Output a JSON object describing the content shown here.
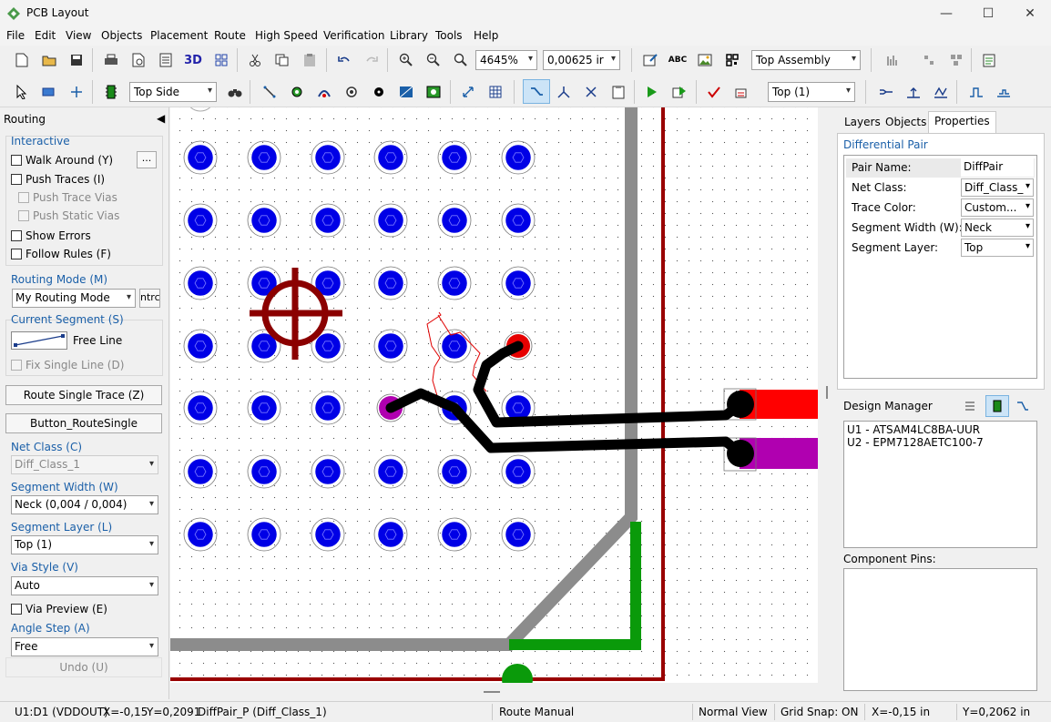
{
  "window": {
    "title": "PCB Layout",
    "minimize": "—",
    "maximize": "☐",
    "close": "✕"
  },
  "menu": [
    "File",
    "Edit",
    "View",
    "Objects",
    "Placement",
    "Route",
    "High Speed",
    "Verification",
    "Library",
    "Tools",
    "Help"
  ],
  "toolbar": {
    "zoom_value": "4645%",
    "grid_value": "0,00625 ir",
    "assembly_view": "Top Assembly",
    "side": "Top Side",
    "layer": "Top (1)",
    "label_3d": "3D",
    "label_abc": "ABC"
  },
  "left_panel": {
    "title": "Routing",
    "interactive": "Interactive",
    "walk_around": "Walk Around (Y)",
    "more": "...",
    "push_traces": "Push Traces (I)",
    "push_trace_vias": "Push Trace Vias",
    "push_static_vias": "Push Static Vias",
    "show_errors": "Show Errors",
    "follow_rules": "Follow Rules (F)",
    "routing_mode_label": "Routing Mode (M)",
    "routing_mode": "My Routing Mode",
    "routing_mode_btn": "ntrc",
    "current_segment_label": "Current Segment (S)",
    "segment_type": "Free Line",
    "fix_single_line": "Fix Single Line (D)",
    "route_single": "Route Single Trace (Z)",
    "button_route_single": "Button_RouteSingle",
    "net_class_label": "Net Class (C)",
    "net_class": "Diff_Class_1",
    "segment_width_label": "Segment Width (W)",
    "segment_width": "Neck (0,004 / 0,004)",
    "segment_layer_label": "Segment Layer (L)",
    "segment_layer": "Top (1)",
    "via_style_label": "Via Style (V)",
    "via_style": "Auto",
    "via_preview": "Via Preview (E)",
    "angle_step_label": "Angle Step (A)",
    "angle_step": "Free",
    "undo": "Undo (U)"
  },
  "right_panel": {
    "tabs": [
      "Layers",
      "Objects",
      "Properties"
    ],
    "section": "Differential Pair",
    "props": [
      {
        "k": "Pair Name:",
        "v": "DiffPair",
        "dropdown": false
      },
      {
        "k": "Net Class:",
        "v": "Diff_Class_",
        "dropdown": true
      },
      {
        "k": "Trace Color:",
        "v": "Custom...",
        "dropdown": true
      },
      {
        "k": "Segment Width (W):",
        "v": "Neck",
        "dropdown": true
      },
      {
        "k": "Segment Layer:",
        "v": "Top",
        "dropdown": true
      }
    ],
    "design_manager": "Design Manager",
    "components": [
      "U1 - ATSAM4LC8BA-UUR",
      "U2 - EPM7128AETC100-7"
    ],
    "component_pins": "Component Pins:"
  },
  "status": {
    "pin": "U1:D1 (VDDOUT)",
    "x": "X=-0,15",
    "y": "Y=0,2091",
    "net": "DiffPair_P (Diff_Class_1)",
    "mode": "Route Manual",
    "view": "Normal View",
    "snap": "Grid Snap: ON",
    "cx": "X=-0,15 in",
    "cy": "Y=0,2062 in"
  },
  "colors": {
    "via": "#0000e6",
    "board_edge": "#990000",
    "grey_trace": "#8c8c8c",
    "green_trace": "#0a9a0a",
    "pad_red": "#ff0000",
    "pad_magenta": "#b000b0",
    "diff_trace": "#000000",
    "accent": "#1a5fa8"
  }
}
